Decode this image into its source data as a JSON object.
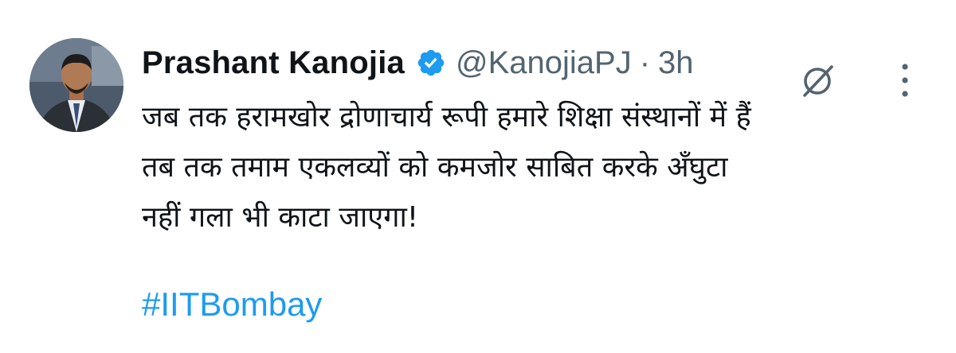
{
  "author": {
    "display_name": "Prashant Kanojia",
    "handle": "@KanojiaPJ",
    "separator": "·",
    "timestamp": "3h",
    "verified_icon": "verified-badge-icon",
    "verified_color": "#1d9bf0"
  },
  "tweet": {
    "lines": [
      "जब तक हरामखोर द्रोणाचार्य रूपी हमारे शिक्षा संस्थानों में हैं",
      "तब तक तमाम एकलव्यों को कमजोर साबित करके अँघुटा",
      "नहीं गला भी काटा जाएगा!"
    ],
    "hashtag": "#IITBombay",
    "hashtag_color": "#1d9bf0"
  },
  "actions": {
    "grok_icon": "grok-icon",
    "more_icon": "more-options-icon"
  }
}
